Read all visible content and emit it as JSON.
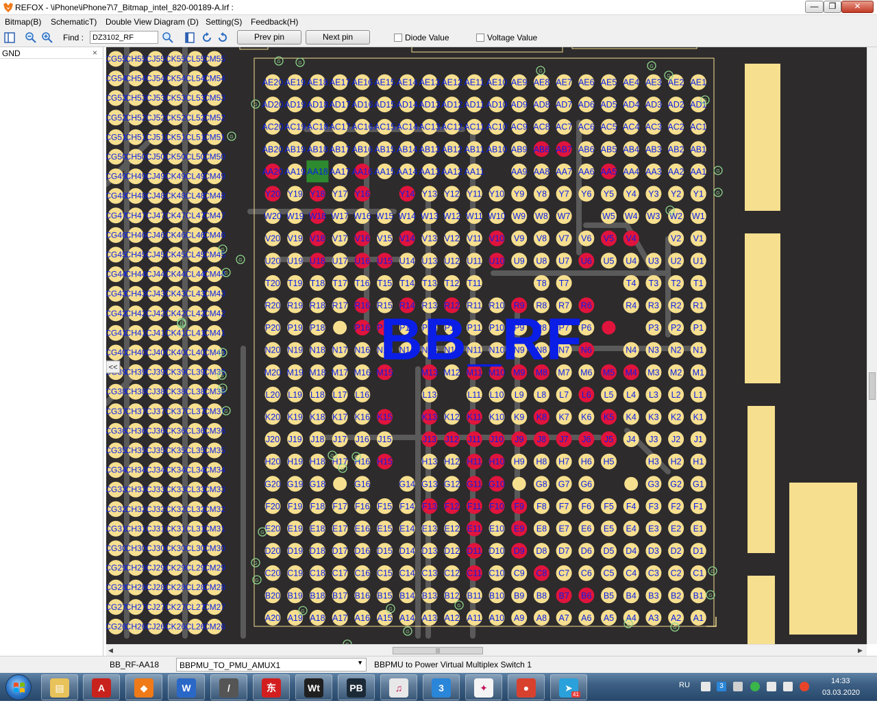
{
  "window": {
    "title": "REFOX - \\iPhone\\iPhone7\\7_Bitmap_intel_820-00189-A.lrf :",
    "minimize_label": "—",
    "restore_label": "❐",
    "close_label": "✕"
  },
  "menu": {
    "items": [
      "Bitmap(B)",
      "SchematicT)",
      "Double View Diagram (D)",
      "Setting(S)",
      "Feedback(H)"
    ]
  },
  "toolbar": {
    "find_label": "Find :",
    "find_value": "DZ3102_RF",
    "prev_pin_label": "Prev pin",
    "next_pin_label": "Next pin",
    "diode_value_label": "Diode Value",
    "voltage_value_label": "Voltage Value",
    "diode_value_checked": false,
    "voltage_value_checked": false
  },
  "side_panel": {
    "title": "GND",
    "close_label": "×"
  },
  "board": {
    "component_label": "BB_RF",
    "label_color": "#0a1ee6",
    "pad_color": "#f6df8f",
    "active_pad_color": "#e0143c",
    "selected_pad_color": "#2e8a2e",
    "background_color": "#2d2b2c",
    "trace_color": "#5b5a5a",
    "outline_color": "#f6df8f",
    "collapse_toggle": "<<",
    "via_symbol": "G",
    "grid_pin_columns": [
      "20",
      "19",
      "18",
      "17",
      "16",
      "15",
      "14",
      "13",
      "12",
      "11",
      "10",
      "9",
      "8",
      "7",
      "6",
      "5",
      "4",
      "3",
      "2",
      "1"
    ],
    "left_columns_prefix": [
      "CG",
      "CH",
      "CJ",
      "CK",
      "CL",
      "CM"
    ],
    "left_rows_suffix": [
      "55",
      "54",
      "53",
      "52",
      "51",
      "50",
      "49",
      "48",
      "47",
      "46",
      "45",
      "44",
      "43",
      "42",
      "41",
      "40",
      "39",
      "38",
      "37",
      "36",
      "35",
      "34",
      "33",
      "32",
      "31",
      "30",
      "29",
      "28",
      "27",
      "26"
    ],
    "grid_rows": [
      {
        "letter": "AE",
        "pins": [
          "AE20",
          "AE19",
          "AE18",
          "AE17",
          "AE16",
          "AE15",
          "AE14",
          "AE13",
          "AE12",
          "AE11",
          "AE10",
          "AE9",
          "AE8",
          "AE7",
          "AE6",
          "AE5",
          "AE4",
          "AE3",
          "AE2",
          "AE1"
        ],
        "active": []
      },
      {
        "letter": "AD",
        "pins": [
          "AD20",
          "AD19",
          "AD18",
          "AD17",
          "AD16",
          "AD15",
          "AD14",
          "AD13",
          "AD12",
          "AD11",
          "AD10",
          "AD9",
          "AD8",
          "AD7",
          "AD6",
          "AD5",
          "AD4",
          "AD3",
          "AD2",
          "AD1"
        ],
        "active": []
      },
      {
        "letter": "AC",
        "pins": [
          "AC20",
          "AC19",
          "AC18",
          "AC17",
          "AC16",
          "AC15",
          "AC14",
          "AC13",
          "AC12",
          "AC11",
          "AC10",
          "AC9",
          "AC8",
          "AC7",
          "AC6",
          "AC5",
          "AC4",
          "AC3",
          "AC2",
          "AC1"
        ],
        "active": []
      },
      {
        "letter": "AB",
        "pins": [
          "AB20",
          "AB19",
          "AB18",
          "AB17",
          "AB16",
          "AB15",
          "AB14",
          "AB13",
          "AB12",
          "AB11",
          "AB10",
          "AB9",
          "AB8",
          "AB7",
          "AB6",
          "AB5",
          "AB4",
          "AB3",
          "AB2",
          "AB1"
        ],
        "active": [
          "AB8",
          "AB7"
        ]
      },
      {
        "letter": "AA",
        "pins": [
          "AA20",
          "AA19",
          "AA18",
          "AA17",
          "AA16",
          "AA15",
          "AA14",
          "AA13",
          "AA12",
          "AA11",
          "",
          "AA9",
          "AA8",
          "AA7",
          "AA6",
          "AA5",
          "AA4",
          "AA3",
          "AA2",
          "AA1"
        ],
        "active": [
          "AA20",
          "AA16",
          "AA5"
        ],
        "selected": "AA18"
      },
      {
        "letter": "Y",
        "pins": [
          "Y20",
          "Y19",
          "Y18",
          "Y17",
          "Y16",
          "",
          "Y14",
          "Y13",
          "Y12",
          "Y11",
          "Y10",
          "Y9",
          "Y8",
          "Y7",
          "Y6",
          "Y5",
          "Y4",
          "Y3",
          "Y2",
          "Y1"
        ],
        "active": [
          "Y20",
          "Y18",
          "Y16",
          "Y14"
        ]
      },
      {
        "letter": "W",
        "pins": [
          "W20",
          "W19",
          "W18",
          "W17",
          "W16",
          "W15",
          "W14",
          "W13",
          "W12",
          "W11",
          "W10",
          "W9",
          "W8",
          "W7",
          "",
          "W5",
          "W4",
          "W3",
          "W2",
          "W1"
        ],
        "active": [
          "W18"
        ]
      },
      {
        "letter": "V",
        "pins": [
          "V20",
          "V19",
          "V18",
          "V17",
          "V16",
          "V15",
          "V14",
          "V13",
          "V12",
          "V11",
          "V10",
          "V9",
          "V8",
          "V7",
          "V6",
          "V5",
          "V4",
          "",
          "V2",
          "V1"
        ],
        "active": [
          "V18",
          "V16",
          "V14",
          "V10",
          "V5",
          "V4"
        ]
      },
      {
        "letter": "U",
        "pins": [
          "U20",
          "U19",
          "U18",
          "U17",
          "U16",
          "U15",
          "U14",
          "U13",
          "U12",
          "U11",
          "U10",
          "U9",
          "U8",
          "U7",
          "U6",
          "U5",
          "U4",
          "U3",
          "U2",
          "U1"
        ],
        "active": [
          "U18",
          "U16",
          "U15",
          "U10",
          "U6"
        ]
      },
      {
        "letter": "T",
        "pins": [
          "T20",
          "T19",
          "T18",
          "T17",
          "T16",
          "T15",
          "T14",
          "T13",
          "T12",
          "T11",
          "",
          "",
          "T8",
          "T7",
          "",
          "",
          "T4",
          "T3",
          "T2",
          "T1"
        ],
        "active": []
      },
      {
        "letter": "R",
        "pins": [
          "R20",
          "R19",
          "R18",
          "R17",
          "R16",
          "R15",
          "R14",
          "R13",
          "R12",
          "R11",
          "R10",
          "R9",
          "R8",
          "R7",
          "R6",
          "",
          "R4",
          "R3",
          "R2",
          "R1"
        ],
        "active": [
          "R16",
          "R14",
          "R12",
          "R9",
          "R6"
        ]
      },
      {
        "letter": "P",
        "pins": [
          "P20",
          "P19",
          "P18",
          "",
          "P16",
          "P15",
          "P14",
          "P13",
          "P12",
          "P11",
          "P10",
          "P9",
          "P8",
          "P7",
          "P6",
          "",
          "",
          "P3",
          "P2",
          "P1"
        ],
        "active": [
          "P16",
          "P15"
        ]
      },
      {
        "letter": "N",
        "pins": [
          "N20",
          "N19",
          "N18",
          "N17",
          "N16",
          "N15",
          "N14",
          "N13",
          "N12",
          "N11",
          "N10",
          "N9",
          "N8",
          "N7",
          "N6",
          "",
          "N4",
          "N3",
          "N2",
          "N1"
        ],
        "active": [
          "N6"
        ]
      },
      {
        "letter": "M",
        "pins": [
          "M20",
          "M19",
          "M18",
          "M17",
          "M16",
          "M15",
          "",
          "M13",
          "M12",
          "M11",
          "M10",
          "M9",
          "M8",
          "M7",
          "M6",
          "M5",
          "M4",
          "M3",
          "M2",
          "M1"
        ],
        "active": [
          "M15",
          "M13",
          "M11",
          "M10",
          "M9",
          "M8",
          "M5",
          "M4"
        ]
      },
      {
        "letter": "L",
        "pins": [
          "L20",
          "L19",
          "L18",
          "L17",
          "L16",
          "",
          "",
          "L13",
          "",
          "L11",
          "L10",
          "L9",
          "L8",
          "L7",
          "L6",
          "L5",
          "L4",
          "L3",
          "L2",
          "L1"
        ],
        "active": [
          "L6"
        ]
      },
      {
        "letter": "K",
        "pins": [
          "K20",
          "K19",
          "K18",
          "K17",
          "K16",
          "K15",
          "",
          "K13",
          "K12",
          "K11",
          "K10",
          "K9",
          "K8",
          "K7",
          "K6",
          "K5",
          "K4",
          "K3",
          "K2",
          "K1"
        ],
        "active": [
          "K15",
          "K13",
          "K11",
          "K8",
          "K5"
        ]
      },
      {
        "letter": "J",
        "pins": [
          "J20",
          "J19",
          "J18",
          "J17",
          "J16",
          "J15",
          "",
          "J13",
          "J12",
          "J11",
          "J10",
          "J9",
          "J8",
          "J7",
          "J6",
          "J5",
          "J4",
          "J3",
          "J2",
          "J1"
        ],
        "active": [
          "J13",
          "J12",
          "J11",
          "J10",
          "J9",
          "J8",
          "J7",
          "J6",
          "J5"
        ]
      },
      {
        "letter": "H",
        "pins": [
          "H20",
          "H19",
          "H18",
          "H17",
          "H16",
          "H15",
          "",
          "H13",
          "H12",
          "H11",
          "H10",
          "H9",
          "H8",
          "H7",
          "H6",
          "H5",
          "",
          "H3",
          "H2",
          "H1"
        ],
        "active": [
          "H15",
          "H11",
          "H10"
        ]
      },
      {
        "letter": "G",
        "pins": [
          "G20",
          "G19",
          "G18",
          "",
          "G16",
          "",
          "G14",
          "G13",
          "G12",
          "G11",
          "G10",
          "",
          "G8",
          "G7",
          "G6",
          "",
          "",
          "G3",
          "G2",
          "G1"
        ],
        "active": [
          "G11",
          "G10"
        ]
      },
      {
        "letter": "F",
        "pins": [
          "F20",
          "F19",
          "F18",
          "F17",
          "F16",
          "F15",
          "F14",
          "F13",
          "F12",
          "F11",
          "F10",
          "F9",
          "F8",
          "F7",
          "F6",
          "F5",
          "F4",
          "F3",
          "F2",
          "F1"
        ],
        "active": [
          "F13",
          "F12",
          "F11",
          "F10",
          "F9"
        ]
      },
      {
        "letter": "E",
        "pins": [
          "E20",
          "E19",
          "E18",
          "E17",
          "E16",
          "E15",
          "E14",
          "E13",
          "E12",
          "E11",
          "E10",
          "E9",
          "E8",
          "E7",
          "E6",
          "E5",
          "E4",
          "E3",
          "E2",
          "E1"
        ],
        "active": [
          "E11",
          "E9"
        ]
      },
      {
        "letter": "D",
        "pins": [
          "D20",
          "D19",
          "D18",
          "D17",
          "D16",
          "D15",
          "D14",
          "D13",
          "D12",
          "D11",
          "D10",
          "D9",
          "D8",
          "D7",
          "D6",
          "D5",
          "D4",
          "D3",
          "D2",
          "D1"
        ],
        "active": [
          "D11",
          "D9"
        ]
      },
      {
        "letter": "C",
        "pins": [
          "C20",
          "C19",
          "C18",
          "C17",
          "C16",
          "C15",
          "C14",
          "C13",
          "C12",
          "C11",
          "C10",
          "C9",
          "C8",
          "C7",
          "C6",
          "C5",
          "C4",
          "C3",
          "C2",
          "C1"
        ],
        "active": [
          "C11",
          "C8"
        ]
      },
      {
        "letter": "B",
        "pins": [
          "B20",
          "B19",
          "B18",
          "B17",
          "B16",
          "B15",
          "B14",
          "B13",
          "B12",
          "B11",
          "B10",
          "B9",
          "B8",
          "B7",
          "B6",
          "B5",
          "B4",
          "B3",
          "B2",
          "B1"
        ],
        "active": [
          "B7",
          "B6"
        ]
      },
      {
        "letter": "A",
        "pins": [
          "A20",
          "A19",
          "A18",
          "A17",
          "A16",
          "A15",
          "A14",
          "A13",
          "A12",
          "A11",
          "A10",
          "A9",
          "A8",
          "A7",
          "A6",
          "A5",
          "A4",
          "A3",
          "A2",
          "A1"
        ],
        "active": []
      }
    ],
    "blank_pads": [
      "P17",
      "G17",
      "G9",
      "P5",
      "G4"
    ]
  },
  "scroll": {
    "hthumb_grip": "|||"
  },
  "status": {
    "pin": "BB_RF-AA18",
    "net": "BBPMU_TO_PMU_AMUX1",
    "net_arrow": "▼",
    "description": "BBPMU to Power Virtual Multiplex Switch 1"
  },
  "taskbar": {
    "apps": [
      {
        "name": "explorer",
        "glyph": "▤",
        "color": "#e8c25a"
      },
      {
        "name": "acrobat",
        "glyph": "A",
        "color": "#c8221c"
      },
      {
        "name": "refox",
        "glyph": "◆",
        "color": "#f07a18"
      },
      {
        "name": "app-blue-red",
        "glyph": "W",
        "color": "#2a68c8"
      },
      {
        "name": "app-pen",
        "glyph": "/",
        "color": "#555555"
      },
      {
        "name": "app-dongzi",
        "glyph": "东",
        "color": "#d21e1e"
      },
      {
        "name": "app-wt",
        "glyph": "Wt",
        "color": "#202020"
      },
      {
        "name": "app-pb",
        "glyph": "PB",
        "color": "#1c2a38"
      },
      {
        "name": "itunes",
        "glyph": "♫",
        "color": "#e8e8e8"
      },
      {
        "name": "app-3",
        "glyph": "3",
        "color": "#2a86d8"
      },
      {
        "name": "app-star",
        "glyph": "✦",
        "color": "#f4f4f4"
      },
      {
        "name": "chrome",
        "glyph": "●",
        "color": "#d9412f"
      },
      {
        "name": "telegram",
        "glyph": "➤",
        "color": "#2aa1da",
        "badge": "41"
      }
    ],
    "language": "RU",
    "tray_badge": "3",
    "time": "14:33",
    "date": "03.03.2020"
  }
}
